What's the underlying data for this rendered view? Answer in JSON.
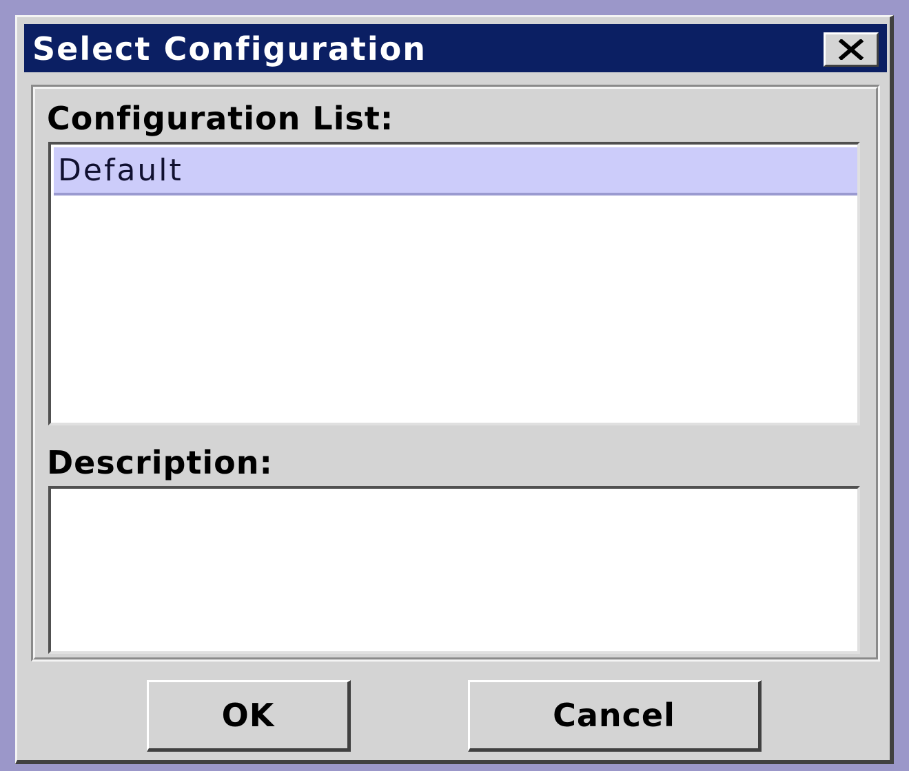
{
  "window": {
    "title": "Select Configuration",
    "close_icon": "close-icon"
  },
  "configuration": {
    "label": "Configuration List:",
    "items": [
      {
        "label": "Default",
        "selected": true
      }
    ]
  },
  "description": {
    "label": "Description:",
    "value": ""
  },
  "buttons": {
    "ok_label": "OK",
    "cancel_label": "Cancel"
  },
  "colors": {
    "titlebar": "#0b1f63",
    "selection": "#ccccfa",
    "dialog_bg": "#d4d4d4",
    "desktop": "#9b97c9"
  }
}
